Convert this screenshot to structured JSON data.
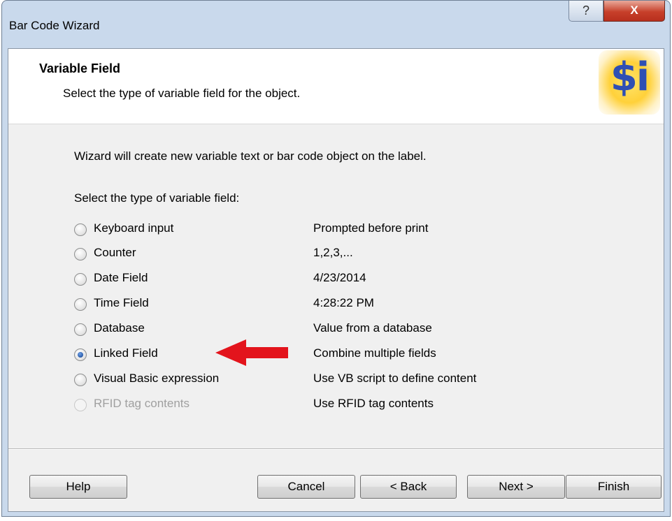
{
  "window": {
    "title": "Bar Code Wizard",
    "help_glyph": "?",
    "close_glyph": "X"
  },
  "header": {
    "title": "Variable Field",
    "subtitle": "Select the type of variable field for the object.",
    "logo_text": "$i",
    "logo_icon": "dollar-info-icon"
  },
  "body": {
    "intro": "Wizard will create new variable text or bar code object on the label.",
    "select_label": "Select the type of variable field:"
  },
  "options": [
    {
      "label": "Keyboard input",
      "description": "Prompted before print",
      "checked": false,
      "disabled": false
    },
    {
      "label": "Counter",
      "description": "1,2,3,...",
      "checked": false,
      "disabled": false
    },
    {
      "label": "Date Field",
      "description": "4/23/2014",
      "checked": false,
      "disabled": false
    },
    {
      "label": "Time Field",
      "description": "4:28:22 PM",
      "checked": false,
      "disabled": false
    },
    {
      "label": "Database",
      "description": "Value from a database",
      "checked": false,
      "disabled": false
    },
    {
      "label": "Linked Field",
      "description": "Combine multiple fields",
      "checked": true,
      "disabled": false
    },
    {
      "label": "Visual Basic expression",
      "description": "Use VB script to define content",
      "checked": false,
      "disabled": false
    },
    {
      "label": "RFID tag contents",
      "description": "Use RFID tag contents",
      "checked": false,
      "disabled": true
    }
  ],
  "annotation": {
    "arrow_icon": "red-arrow-left-icon",
    "color": "#e3141c"
  },
  "buttons": {
    "help": "Help",
    "cancel": "Cancel",
    "back": "< Back",
    "next": "Next >",
    "finish": "Finish"
  }
}
